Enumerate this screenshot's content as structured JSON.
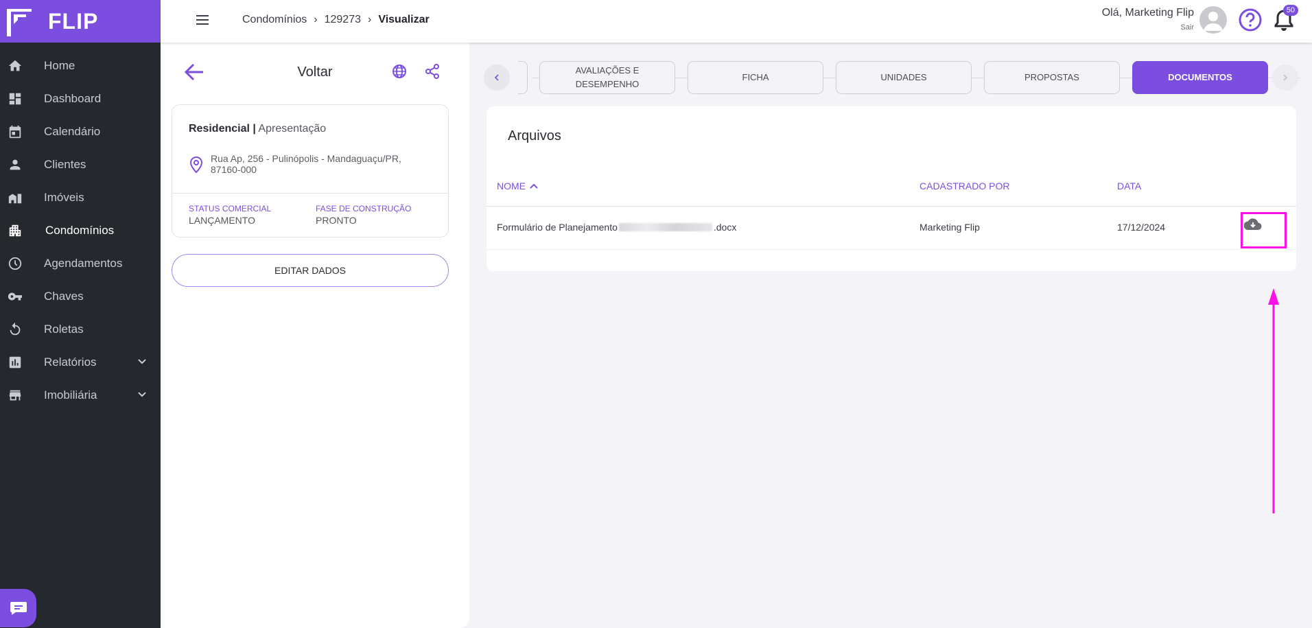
{
  "brand": {
    "name": "FLIP"
  },
  "sidebar": {
    "items": [
      {
        "label": "Home",
        "icon": "home-icon"
      },
      {
        "label": "Dashboard",
        "icon": "dashboard-icon"
      },
      {
        "label": "Calendário",
        "icon": "calendar-icon"
      },
      {
        "label": "Clientes",
        "icon": "person-icon"
      },
      {
        "label": "Imóveis",
        "icon": "buildings-icon"
      },
      {
        "label": "Condomínios",
        "icon": "apartment-icon",
        "active": true
      },
      {
        "label": "Agendamentos",
        "icon": "clock-icon"
      },
      {
        "label": "Chaves",
        "icon": "key-icon"
      },
      {
        "label": "Roletas",
        "icon": "rotate-icon"
      },
      {
        "label": "Relatórios",
        "icon": "chart-icon",
        "expandable": true
      },
      {
        "label": "Imobiliária",
        "icon": "store-icon",
        "expandable": true
      }
    ]
  },
  "topbar": {
    "breadcrumb": [
      "Condomínios",
      "129273",
      "Visualizar"
    ],
    "greeting": "Olá, Marketing Flip",
    "logout": "Sair",
    "notifications": "50"
  },
  "panel": {
    "back_label": "Voltar",
    "card": {
      "type": "Residencial |",
      "subtitle": "Apresentação",
      "address_line1": "Rua Ap, 256 - Pulinópolis - Mandaguaçu/PR,",
      "address_line2": "87160-000",
      "status_label": "STATUS COMERCIAL",
      "status_value": "LANÇAMENTO",
      "phase_label": "FASE DE CONSTRUÇÃO",
      "phase_value": "PRONTO"
    },
    "edit_button": "EDITAR DADOS"
  },
  "tabs": {
    "items": [
      {
        "line1": "AVALIAÇÕES E",
        "line2": "DESEMPENHO"
      },
      {
        "line1": "FICHA",
        "line2": ""
      },
      {
        "line1": "UNIDADES",
        "line2": ""
      },
      {
        "line1": "PROPOSTAS",
        "line2": ""
      },
      {
        "line1": "DOCUMENTOS",
        "line2": "",
        "active": true
      }
    ]
  },
  "files": {
    "title": "Arquivos",
    "columns": {
      "name": "NOME",
      "registered_by": "CADASTRADO POR",
      "date": "DATA"
    },
    "rows": [
      {
        "name_prefix": "Formulário de Planejamento",
        "name_suffix": ".docx",
        "registered_by": "Marketing Flip",
        "date": "17/12/2024"
      }
    ]
  },
  "colors": {
    "accent": "#7b4ee0",
    "sidebar": "#25292e",
    "annotation": "#ff10e6"
  }
}
